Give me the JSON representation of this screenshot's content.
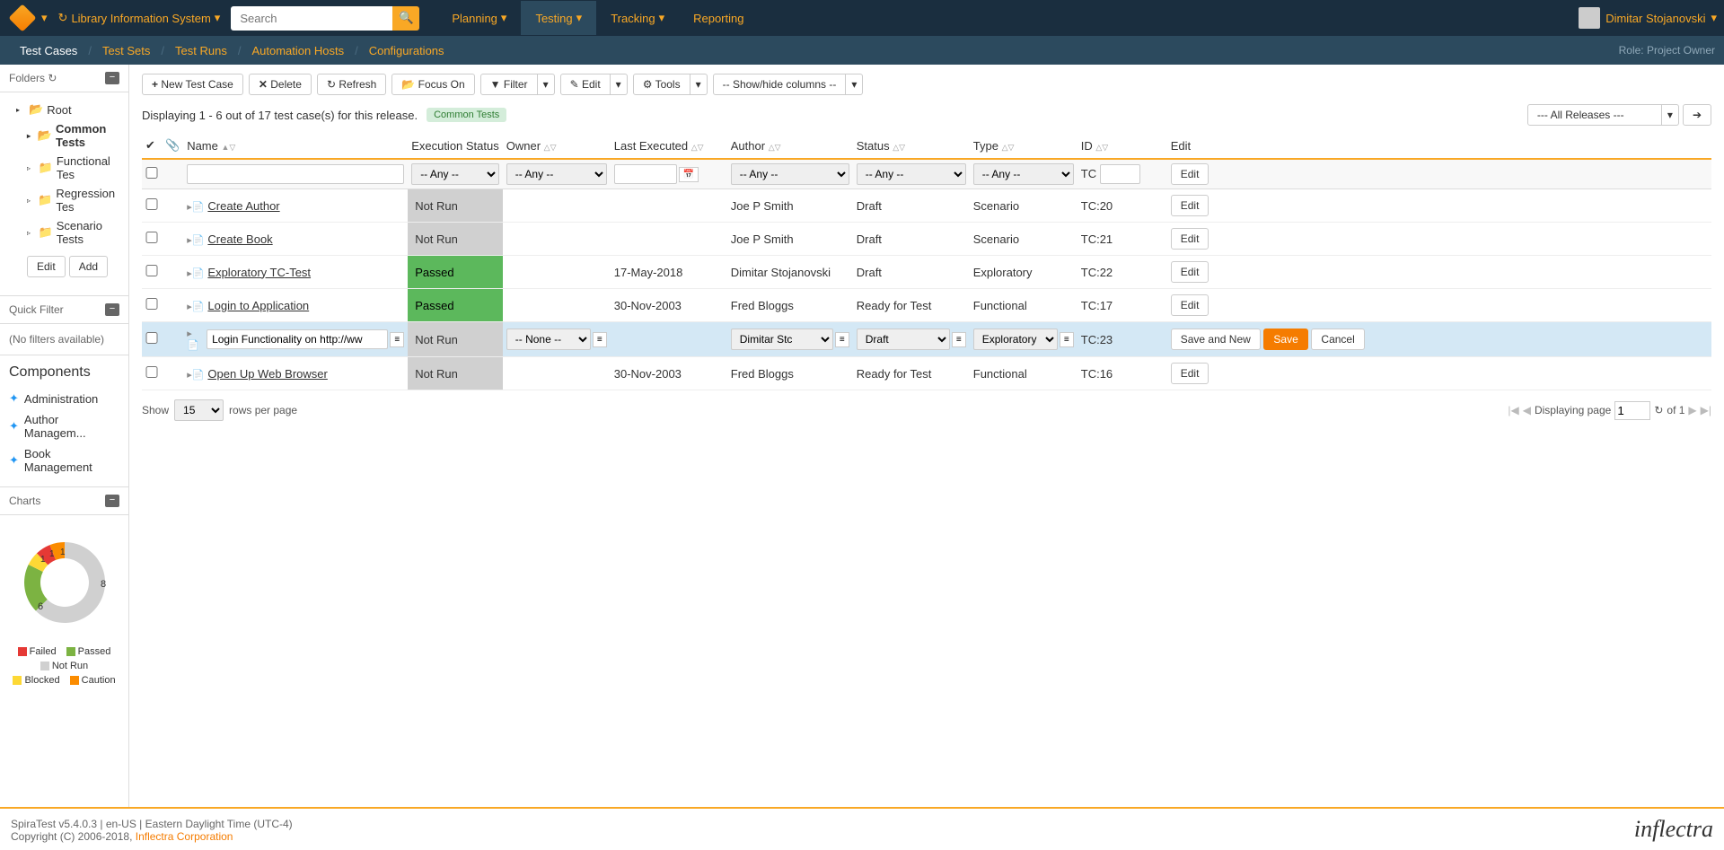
{
  "topbar": {
    "project": "Library Information System",
    "search_placeholder": "Search",
    "nav": [
      "Planning",
      "Testing",
      "Tracking",
      "Reporting"
    ],
    "nav_active": 1,
    "user": "Dimitar Stojanovski"
  },
  "subnav": {
    "tabs": [
      "Test Cases",
      "Test Sets",
      "Test Runs",
      "Automation Hosts",
      "Configurations"
    ],
    "active": 0,
    "role": "Role: Project Owner"
  },
  "sidebar": {
    "folders_label": "Folders",
    "tree": {
      "root": "Root",
      "children": [
        "Common Tests",
        "Functional Tes",
        "Regression Tes",
        "Scenario Tests"
      ],
      "selected": 0
    },
    "btn_edit": "Edit",
    "btn_add": "Add",
    "quickfilter_label": "Quick Filter",
    "quickfilter_empty": "(No filters available)",
    "components_label": "Components",
    "components": [
      "Administration",
      "Author Managem...",
      "Book Management"
    ],
    "charts_label": "Charts",
    "legend": [
      "Failed",
      "Passed",
      "Not Run",
      "Blocked",
      "Caution"
    ]
  },
  "toolbar": {
    "new": "New Test Case",
    "delete": "Delete",
    "refresh": "Refresh",
    "focus": "Focus On",
    "filter": "Filter",
    "edit": "Edit",
    "tools": "Tools",
    "columns": "-- Show/hide columns --"
  },
  "info": {
    "display_text": "Displaying 1 - 6 out of 17 test case(s) for this release.",
    "badge": "Common Tests",
    "release_sel": "--- All Releases ---"
  },
  "columns": [
    "",
    "",
    "Name",
    "Execution Status",
    "Owner",
    "Last Executed",
    "Author",
    "Status",
    "Type",
    "ID",
    "Edit"
  ],
  "filters": {
    "any": "-- Any --",
    "id_prefix": "TC",
    "edit": "Edit"
  },
  "rows": [
    {
      "name": "Create Author",
      "exec": "Not Run",
      "exec_class": "notrun",
      "owner": "",
      "last": "",
      "author": "Joe P Smith",
      "status": "Draft",
      "type": "Scenario",
      "id": "TC:20"
    },
    {
      "name": "Create Book",
      "exec": "Not Run",
      "exec_class": "notrun",
      "owner": "",
      "last": "",
      "author": "Joe P Smith",
      "status": "Draft",
      "type": "Scenario",
      "id": "TC:21"
    },
    {
      "name": "Exploratory TC-Test",
      "exec": "Passed",
      "exec_class": "passed",
      "owner": "",
      "last": "17-May-2018",
      "author": "Dimitar Stojanovski",
      "status": "Draft",
      "type": "Exploratory",
      "id": "TC:22"
    },
    {
      "name": "Login to Application",
      "exec": "Passed",
      "exec_class": "passed",
      "owner": "",
      "last": "30-Nov-2003",
      "author": "Fred Bloggs",
      "status": "Ready for Test",
      "type": "Functional",
      "id": "TC:17"
    }
  ],
  "edit_row": {
    "name_value": "Login Functionality on http://ww",
    "exec": "Not Run",
    "owner": "-- None --",
    "author": "Dimitar Stojanovski",
    "status": "Draft",
    "type": "Exploratory",
    "id": "TC:23",
    "save_new": "Save and New",
    "save": "Save",
    "cancel": "Cancel"
  },
  "row_last": {
    "name": "Open Up Web Browser",
    "exec": "Not Run",
    "exec_class": "notrun",
    "owner": "",
    "last": "30-Nov-2003",
    "author": "Fred Bloggs",
    "status": "Ready for Test",
    "type": "Functional",
    "id": "TC:16"
  },
  "pager": {
    "show": "Show",
    "rows_per_page": "rows per page",
    "page_size": "15",
    "displaying": "Displaying page",
    "page": "1",
    "of": "of 1"
  },
  "footer": {
    "line1": "SpiraTest v5.4.0.3 | en-US | Eastern Daylight Time (UTC-4)",
    "line2a": "Copyright (C) 2006-2018, ",
    "line2b": "Inflectra Corporation",
    "brand": "inflectra"
  },
  "chart_data": {
    "type": "pie",
    "title": "",
    "series": [
      {
        "name": "Failed",
        "value": 1,
        "color": "#e53935"
      },
      {
        "name": "Passed",
        "value": 6,
        "color": "#7cb342"
      },
      {
        "name": "Not Run",
        "value": 8,
        "color": "#d0d0d0"
      },
      {
        "name": "Blocked",
        "value": 1,
        "color": "#fdd835"
      },
      {
        "name": "Caution",
        "value": 1,
        "color": "#fb8c00"
      }
    ]
  }
}
